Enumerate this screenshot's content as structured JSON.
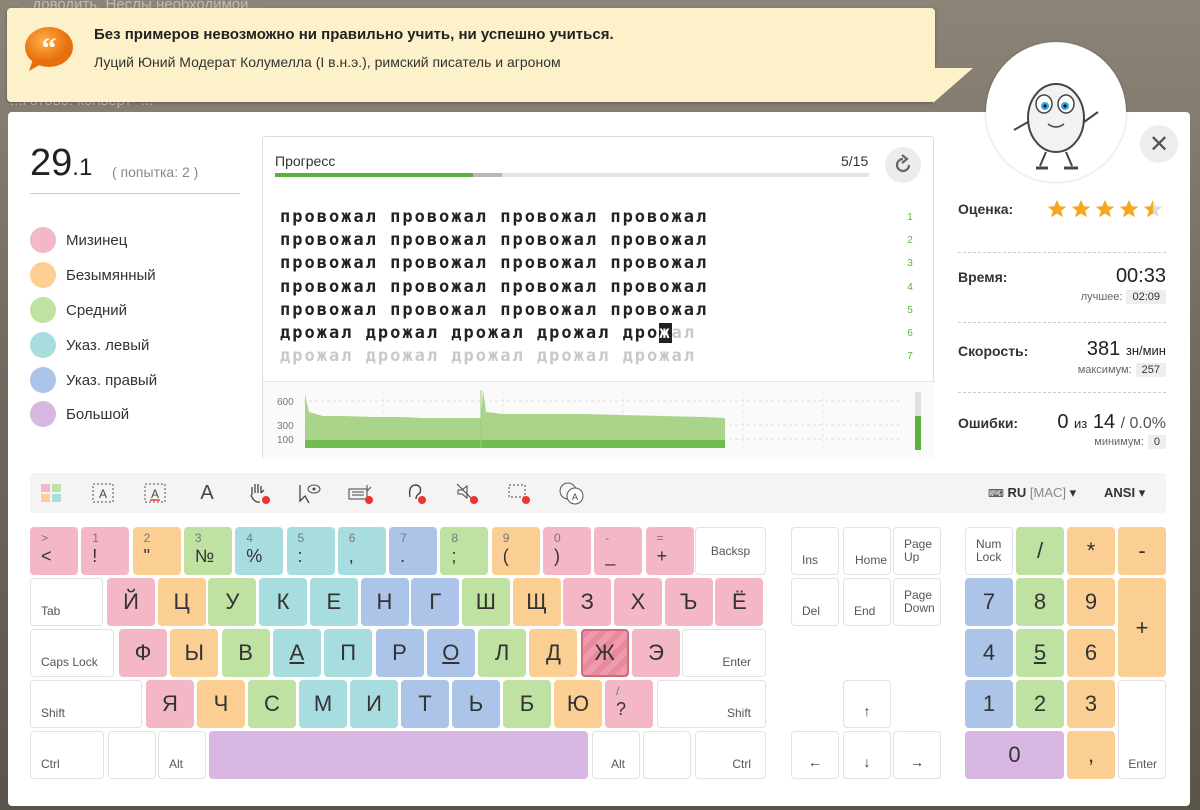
{
  "background": {
    "text_top": "...доводить. Неслы необходимой...",
    "text_second": "...Готово: конверт -...",
    "text_bottom": "...стать только вы..."
  },
  "quote": {
    "text": "Без примеров невозможно ни правильно учить, ни успешно учиться.",
    "author": "Луций Юний Модерат Колумелла (I в.н.э.), римский писатель и агроном"
  },
  "lesson": {
    "score_main": "29",
    "score_decimal": ".1",
    "attempt": "( попытка: 2 )"
  },
  "legend": [
    {
      "label": "Мизинец",
      "color": "#f4b7c6"
    },
    {
      "label": "Безымянный",
      "color": "#fbcf93"
    },
    {
      "label": "Средний",
      "color": "#bfe1a1"
    },
    {
      "label": "Указ. левый",
      "color": "#a8dde0"
    },
    {
      "label": "Указ. правый",
      "color": "#acc4e7"
    },
    {
      "label": "Большой",
      "color": "#d8b7e2"
    }
  ],
  "progress": {
    "label": "Прогресс",
    "count": "5/15",
    "done_fraction": 0.333,
    "pending_fraction": 0.05
  },
  "text_lines": [
    {
      "done": "провожал провожал провожал провожал",
      "no": "1"
    },
    {
      "done": "провожал провожал провожал провожал",
      "no": "2"
    },
    {
      "done": "провожал провожал провожал провожал",
      "no": "3"
    },
    {
      "done": "провожал провожал провожал провожал",
      "no": "4"
    },
    {
      "done": "провожал провожал провожал провожал",
      "no": "5"
    },
    {
      "done": "дрожал дрожал дрожал дрожал дро",
      "cursor": "ж",
      "rest": "ал",
      "no": "6"
    },
    {
      "upcoming": "дрожал дрожал дрожал дрожал дрожал",
      "no": "7"
    }
  ],
  "graph": {
    "y_ticks": [
      "600",
      "300",
      "100"
    ]
  },
  "stats": {
    "rating_label": "Оценка:",
    "rating_stars": 4.5,
    "time_label": "Время:",
    "time_value": "00:33",
    "time_best_label": "лучшее:",
    "time_best": "02:09",
    "speed_label": "Скорость:",
    "speed_value": "381",
    "speed_unit": "зн/мин",
    "speed_max_label": "максимум:",
    "speed_max": "257",
    "errors_label": "Ошибки:",
    "errors_value": "0",
    "errors_of": "из",
    "errors_total": "14",
    "errors_pct": "/ 0.0%",
    "errors_min_label": "минимум:",
    "errors_min": "0"
  },
  "toolbar": {
    "layout": "RU",
    "layout_variant": "[MAC]",
    "standard": "ANSI"
  },
  "keyboard": {
    "row1": [
      {
        "top": ">",
        "bot": "<",
        "c": "pink"
      },
      {
        "top": "1",
        "bot": "!",
        "c": "pink"
      },
      {
        "top": "2",
        "bot": "\"",
        "c": "orange"
      },
      {
        "top": "3",
        "bot": "№",
        "c": "green"
      },
      {
        "top": "4",
        "bot": "%",
        "c": "cyan"
      },
      {
        "top": "5",
        "bot": ":",
        "c": "cyan"
      },
      {
        "top": "6",
        "bot": ",",
        "c": "cyan"
      },
      {
        "top": "7",
        "bot": ".",
        "c": "blue"
      },
      {
        "top": "8",
        "bot": ";",
        "c": "green"
      },
      {
        "top": "9",
        "bot": "(",
        "c": "orange"
      },
      {
        "top": "0",
        "bot": ")",
        "c": "pink"
      },
      {
        "top": "-",
        "bot": "_",
        "c": "pink"
      },
      {
        "top": "=",
        "bot": "+",
        "c": "pink"
      }
    ],
    "backspace": "Backsp",
    "tab": "Tab",
    "row2": [
      {
        "k": "Й",
        "c": "pink"
      },
      {
        "k": "Ц",
        "c": "orange"
      },
      {
        "k": "У",
        "c": "green"
      },
      {
        "k": "К",
        "c": "cyan"
      },
      {
        "k": "Е",
        "c": "cyan"
      },
      {
        "k": "Н",
        "c": "blue"
      },
      {
        "k": "Г",
        "c": "blue"
      },
      {
        "k": "Ш",
        "c": "green"
      },
      {
        "k": "Щ",
        "c": "orange"
      },
      {
        "k": "З",
        "c": "pink"
      },
      {
        "k": "Х",
        "c": "pink"
      },
      {
        "k": "Ъ",
        "c": "pink"
      },
      {
        "k": "Ё",
        "c": "pink"
      }
    ],
    "caps": "Caps Lock",
    "row3": [
      {
        "k": "Ф",
        "c": "pink"
      },
      {
        "k": "Ы",
        "c": "orange"
      },
      {
        "k": "В",
        "c": "green"
      },
      {
        "k": "А",
        "c": "cyan",
        "u": true
      },
      {
        "k": "П",
        "c": "cyan"
      },
      {
        "k": "Р",
        "c": "blue"
      },
      {
        "k": "О",
        "c": "blue",
        "u": true
      },
      {
        "k": "Л",
        "c": "green"
      },
      {
        "k": "Д",
        "c": "orange"
      },
      {
        "k": "Ж",
        "c": "active"
      },
      {
        "k": "Э",
        "c": "pink"
      }
    ],
    "enter": "Enter",
    "shift": "Shift",
    "row4": [
      {
        "k": "Я",
        "c": "pink"
      },
      {
        "k": "Ч",
        "c": "orange"
      },
      {
        "k": "С",
        "c": "green"
      },
      {
        "k": "М",
        "c": "cyan"
      },
      {
        "k": "И",
        "c": "cyan"
      },
      {
        "k": "Т",
        "c": "blue"
      },
      {
        "k": "Ь",
        "c": "blue"
      },
      {
        "k": "Б",
        "c": "green"
      },
      {
        "k": "Ю",
        "c": "orange"
      }
    ],
    "slash_top": "/",
    "slash_bot": "?",
    "ctrl": "Ctrl",
    "alt": "Alt",
    "nav": {
      "ins": "Ins",
      "home": "Home",
      "pgup": "Page Up",
      "del": "Del",
      "end": "End",
      "pgdn": "Page Down",
      "up": "↑",
      "left": "←",
      "down": "↓",
      "right": "→"
    },
    "numpad": {
      "numlock": "Num Lock",
      "div": "/",
      "mul": "*",
      "minus": "-",
      "n7": "7",
      "n8": "8",
      "n9": "9",
      "plus": "+",
      "n4": "4",
      "n5": "5",
      "n6": "6",
      "n1": "1",
      "n2": "2",
      "n3": "3",
      "enter": "Enter",
      "n0": "0",
      "dot": ","
    }
  }
}
